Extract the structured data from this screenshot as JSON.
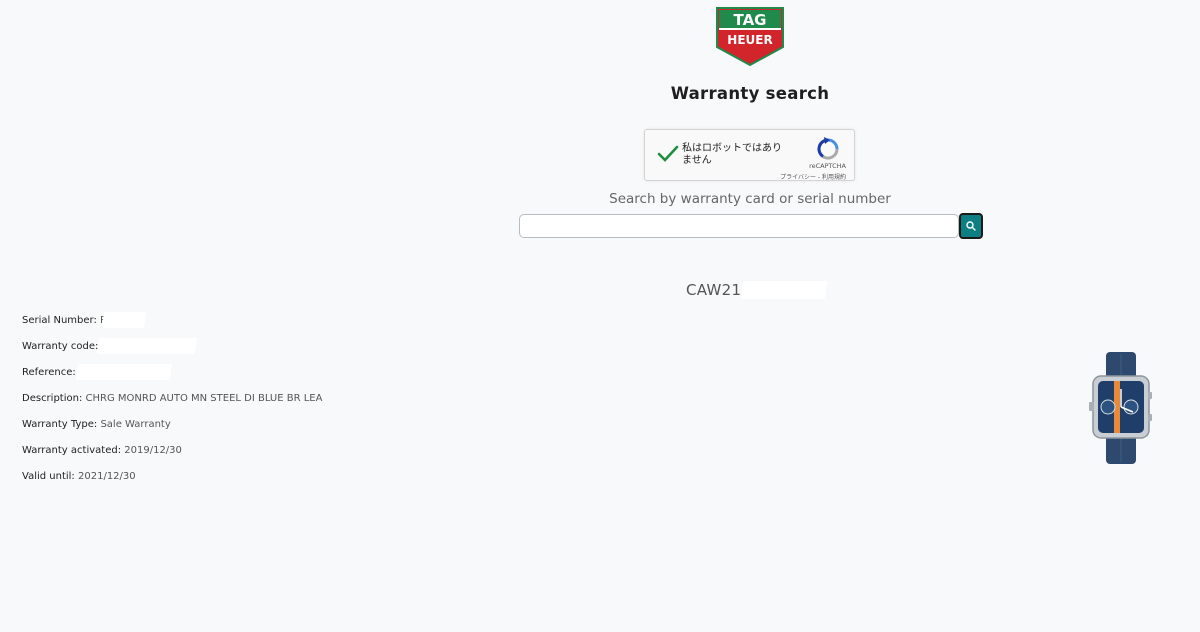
{
  "header": {
    "logo_top": "TAG",
    "logo_bottom": "HEUER",
    "title": "Warranty search"
  },
  "recaptcha": {
    "label": "私はロボットではありません",
    "brand": "reCAPTCHA",
    "links": "プライバシー - 利用規約",
    "checked": true
  },
  "search": {
    "label": "Search by warranty card or serial number",
    "value": "",
    "placeholder": ""
  },
  "result": {
    "reference_prefix": "CAW211",
    "fields": [
      {
        "label": "Serial Number:",
        "value": "R"
      },
      {
        "label": "Warranty code:",
        "value": ""
      },
      {
        "label": "Reference:",
        "value": ""
      },
      {
        "label": "Description:",
        "value": "CHRG MONRD AUTO MN STEEL DI BLUE BR LEA"
      },
      {
        "label": "Warranty Type:",
        "value": "Sale Warranty"
      },
      {
        "label": "Warranty activated:",
        "value": "2019/12/30"
      },
      {
        "label": "Valid until:",
        "value": "2021/12/30"
      }
    ]
  },
  "colors": {
    "accent": "#0d7f83",
    "logo_red": "#d2252b",
    "logo_green": "#1f8a4c",
    "check_green": "#1e8e3e",
    "background": "#f8f9fb"
  },
  "icons": {
    "search": "search-icon",
    "check": "checkmark-icon",
    "recaptcha": "recaptcha-logo-icon"
  }
}
